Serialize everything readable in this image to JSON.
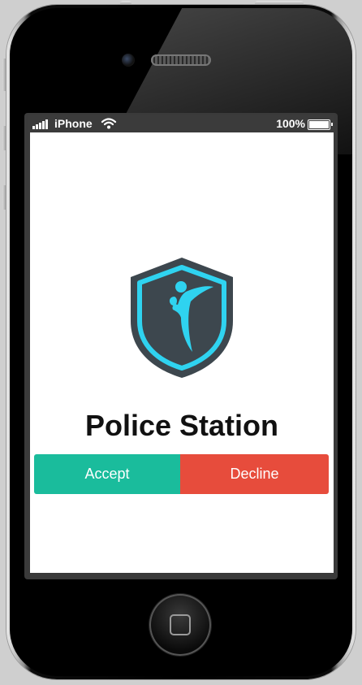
{
  "statusbar": {
    "carrier": "iPhone",
    "battery_text": "100%",
    "battery_level": 1.0,
    "signal_icon": "signal-bars-icon",
    "wifi_icon": "wifi-icon",
    "battery_icon": "battery-icon"
  },
  "app": {
    "logo_icon": "police-shield-logo",
    "title": "Police Station",
    "accept_label": "Accept",
    "decline_label": "Decline"
  },
  "colors": {
    "accept": "#1abc9c",
    "decline": "#e74c3c",
    "shield_dark": "#3d474e",
    "shield_accent": "#2fd3f0"
  },
  "device": {
    "home_button_icon": "home-button-icon"
  }
}
